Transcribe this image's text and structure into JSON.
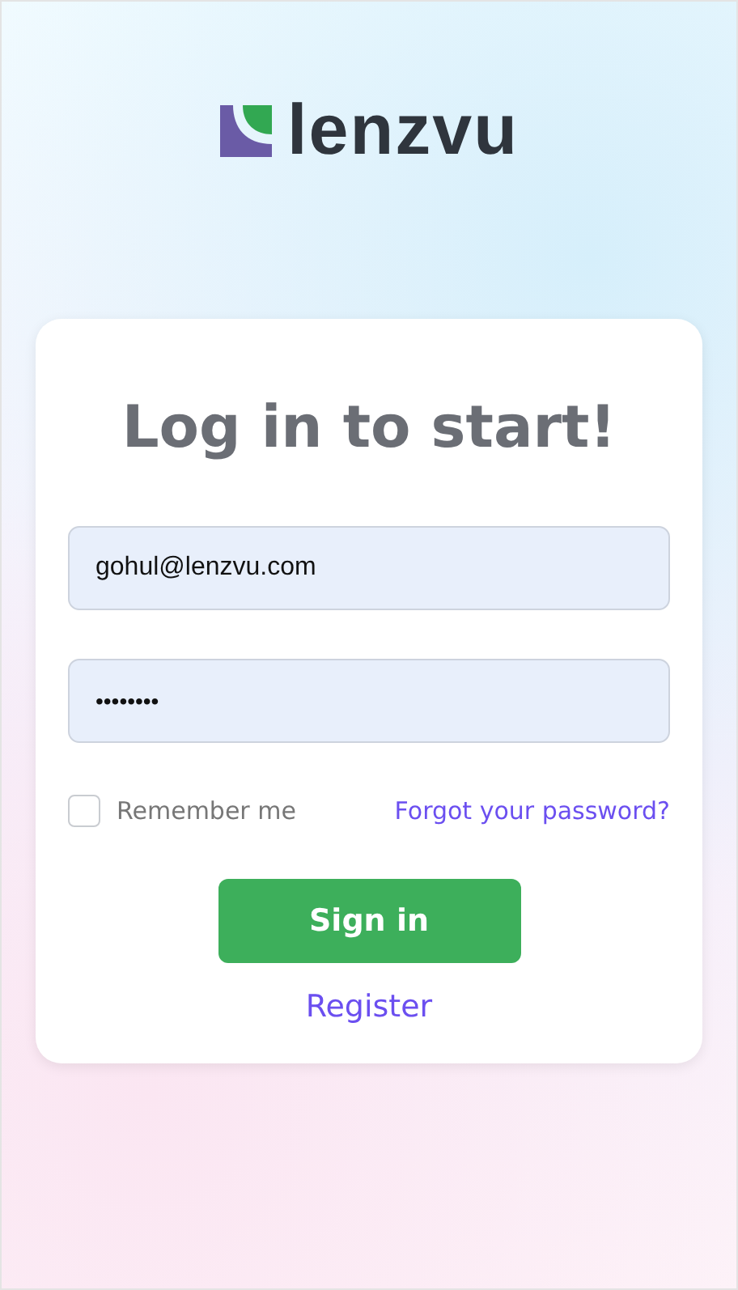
{
  "logo": {
    "text": "lenzvu"
  },
  "form": {
    "title": "Log in to start!",
    "email": {
      "value": "gohul@lenzvu.com"
    },
    "password": {
      "value": "••••••••"
    },
    "remember": {
      "label": "Remember me",
      "checked": false
    },
    "forgot_link": "Forgot your password?",
    "submit": "Sign in",
    "register_link": "Register"
  }
}
